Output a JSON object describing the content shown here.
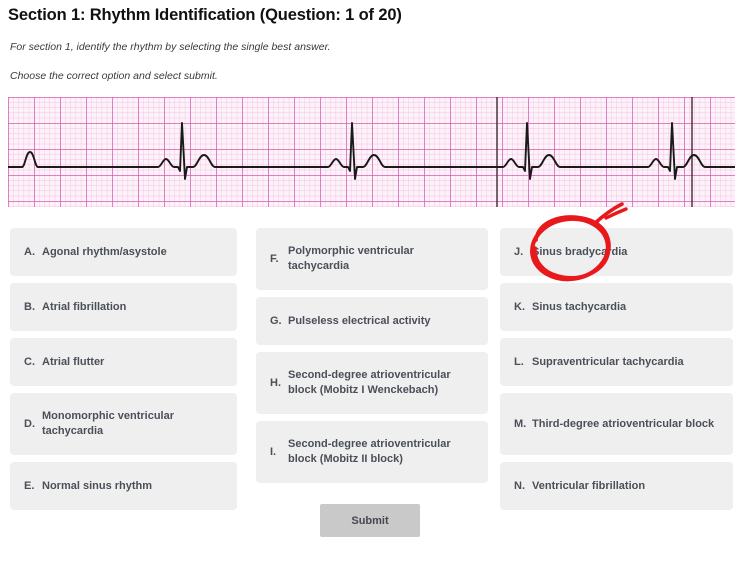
{
  "header": {
    "title": "Section 1: Rhythm Identification (Question: 1 of 20)",
    "instruction_1": "For section 1, identify the rhythm by selecting the single best answer.",
    "instruction_2": "Choose the correct option and select submit."
  },
  "ecg": {
    "name": "ecg-rhythm-strip",
    "grid_minor_color": "#f3c9e3",
    "grid_major_color": "#d458a8",
    "trace_color": "#1a1a1a",
    "background_color": "#fdf4fa",
    "rhythm": "sinus bradycardia",
    "beats": 5
  },
  "annotation": {
    "name": "red-circle-annotation",
    "color": "#e8191b",
    "targets_option": "J"
  },
  "options": {
    "column_1": [
      {
        "letter": "A.",
        "label": "Agonal rhythm/asystole",
        "lines": 1
      },
      {
        "letter": "B.",
        "label": "Atrial fibrillation",
        "lines": 1
      },
      {
        "letter": "C.",
        "label": "Atrial flutter",
        "lines": 1
      },
      {
        "letter": "D.",
        "label": "Monomorphic ventricular tachycardia",
        "lines": 2
      },
      {
        "letter": "E.",
        "label": "Normal sinus rhythm",
        "lines": 1
      }
    ],
    "column_2": [
      {
        "letter": "F.",
        "label": "Polymorphic ventricular tachycardia",
        "lines": 2
      },
      {
        "letter": "G.",
        "label": "Pulseless electrical activity",
        "lines": 1
      },
      {
        "letter": "H.",
        "label": "Second-degree atrioventricular block (Mobitz I Wenckebach)",
        "lines": 2
      },
      {
        "letter": "I.",
        "label": "Second-degree atrioventricular block (Mobitz II block)",
        "lines": 2
      }
    ],
    "column_3": [
      {
        "letter": "J.",
        "label": "Sinus bradycardia",
        "lines": 1
      },
      {
        "letter": "K.",
        "label": "Sinus tachycardia",
        "lines": 1
      },
      {
        "letter": "L.",
        "label": "Supraventricular tachycardia",
        "lines": 1
      },
      {
        "letter": "M.",
        "label": "Third-degree atrioventricular block",
        "lines": 2
      },
      {
        "letter": "N.",
        "label": "Ventricular fibrillation",
        "lines": 1
      }
    ]
  },
  "submit": {
    "label": "Submit"
  }
}
